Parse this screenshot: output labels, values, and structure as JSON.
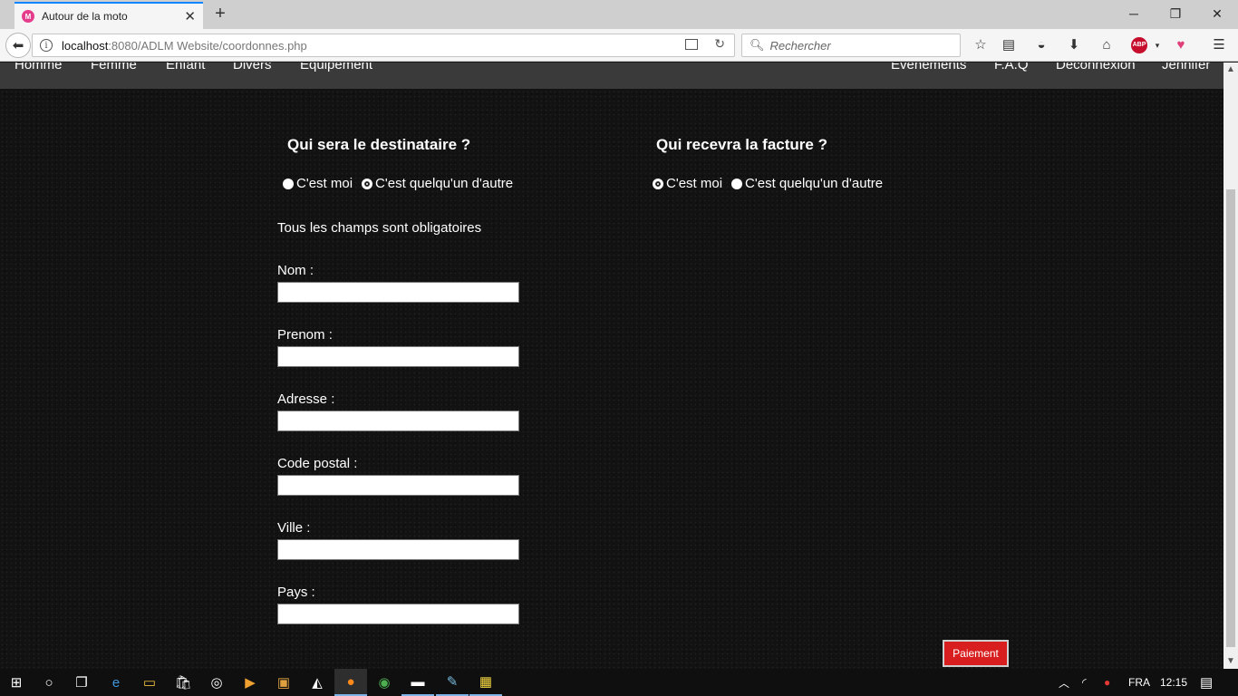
{
  "browser": {
    "tab_title": "Autour de la moto",
    "tab_favicon": "M",
    "tab_close": "✕",
    "new_tab": "+",
    "url_host": "localhost",
    "url_path": ":8080/ADLM Website/coordonnes.php",
    "search_placeholder": "Rechercher",
    "abp_label": "ABP"
  },
  "site_nav": {
    "left": [
      "Homme",
      "Femme",
      "Enfant",
      "Divers",
      "Equipement"
    ],
    "right": [
      "Evenements",
      "F.A.Q",
      "Deconnexion",
      "Jennifer"
    ]
  },
  "destinataire": {
    "title": "Qui sera le destinataire ?",
    "option_me": "C'est moi",
    "option_other": "C'est quelqu'un d'autre",
    "selected": "other"
  },
  "facture": {
    "title": "Qui recevra la facture ?",
    "option_me": "C'est moi",
    "option_other": "C'est quelqu'un d'autre",
    "selected": "me"
  },
  "form": {
    "note": "Tous les champs sont obligatoires",
    "fields": [
      {
        "label": "Nom :",
        "value": ""
      },
      {
        "label": "Prenom :",
        "value": ""
      },
      {
        "label": "Adresse :",
        "value": ""
      },
      {
        "label": "Code postal :",
        "value": ""
      },
      {
        "label": "Ville :",
        "value": ""
      },
      {
        "label": "Pays :",
        "value": ""
      }
    ],
    "submit_label": "Paiement"
  },
  "taskbar": {
    "language": "FRA",
    "time": "12:15"
  }
}
